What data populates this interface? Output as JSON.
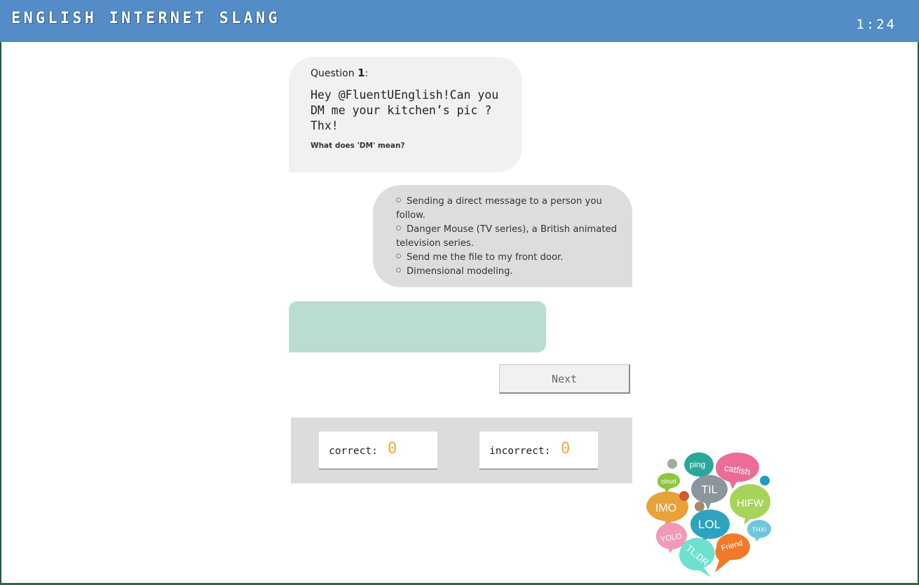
{
  "header": {
    "title": "ENGLISH INTERNET SLANG",
    "timer": "1:24",
    "color": "#538cc6"
  },
  "question": {
    "label": "Question",
    "number": "1",
    "suffix": ":",
    "text": "Hey @FluentUEnglish!Can you DM me your kitchen’s pic ? Thx!",
    "prompt": "What does 'DM' mean?"
  },
  "options": [
    "Sending a direct message to a person you follow.",
    "Danger Mouse (TV series), a British animated television series.",
    "Send me the file to my front door.",
    "Dimensional modeling."
  ],
  "feedback": {
    "text": "",
    "color": "#b9ddd1"
  },
  "next_label": "Next",
  "score": {
    "correct_label": "correct:",
    "correct_value": "0",
    "incorrect_label": "incorrect:",
    "incorrect_value": "0",
    "value_color": "#f0a93b"
  },
  "slang_cloud": {
    "words": [
      "ping",
      "catfish",
      "cloud",
      "TIL",
      "IMO",
      "HIFW",
      "LOL",
      "YOLO",
      "THX!",
      "Friend",
      "TL;DR"
    ]
  }
}
